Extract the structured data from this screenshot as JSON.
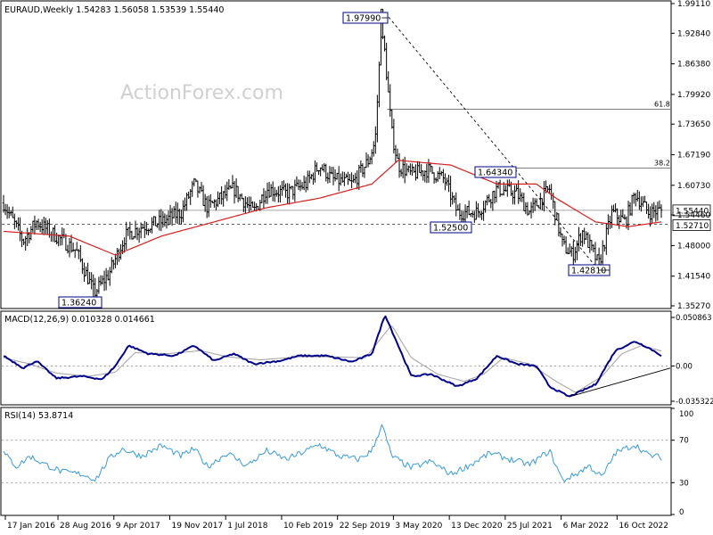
{
  "colors": {
    "price": "#000000",
    "ma": "#d42020",
    "macd": "#00008b",
    "signal": "#a0a0a0",
    "rsi": "#3a9ad9",
    "grid": "#c8c8c8",
    "frame": "#000000",
    "label_border": "#00008b",
    "watermark": "#d0d0d0"
  },
  "chart_data": [
    {
      "type": "bar",
      "panel": "price",
      "title": "EURAUD,Weekly  1.54283 1.56058 1.53539 1.55440",
      "watermark": "ActionForex.com",
      "ylim": [
        1.3527,
        1.9911
      ],
      "y_ticks": [
        1.9911,
        1.9284,
        1.8638,
        1.7992,
        1.7365,
        1.6719,
        1.6073,
        1.5446,
        1.48,
        1.4154,
        1.3527
      ],
      "x_tick_labels": [
        "17 Jan 2016",
        "28 Aug 2016",
        "9 Apr 2017",
        "19 Nov 2017",
        "1 Jul 2018",
        "10 Feb 2019",
        "22 Sep 2019",
        "3 May 2020",
        "13 Dec 2020",
        "25 Jul 2021",
        "6 Mar 2022",
        "16 Oct 2022"
      ],
      "price_labels": [
        "1.97990",
        "1.64340",
        "1.52500",
        "1.36240",
        "1.42810"
      ],
      "right_labels": [
        "1.55440",
        "1.52710"
      ],
      "fib_labels": [
        "61.8",
        "38.2"
      ],
      "levels": {
        "high": 1.9799,
        "fib_61_8": 1.7679,
        "fib_38_2": 1.6434,
        "last": 1.5544,
        "support": 1.525,
        "right_support": 1.5271,
        "low_2022": 1.4281,
        "low_2016": 1.3624
      },
      "trendline": {
        "from": [
          1.9799,
          0
        ],
        "to": [
          1.4281,
          1
        ]
      },
      "anchors": [
        {
          "t": 0.0,
          "c": 1.57
        },
        {
          "t": 0.03,
          "c": 1.49
        },
        {
          "t": 0.05,
          "c": 1.53
        },
        {
          "t": 0.08,
          "c": 1.5
        },
        {
          "t": 0.11,
          "c": 1.47
        },
        {
          "t": 0.138,
          "c": 1.38
        },
        {
          "t": 0.16,
          "c": 1.42
        },
        {
          "t": 0.185,
          "c": 1.5
        },
        {
          "t": 0.21,
          "c": 1.52
        },
        {
          "t": 0.24,
          "c": 1.53
        },
        {
          "t": 0.27,
          "c": 1.55
        },
        {
          "t": 0.29,
          "c": 1.61
        },
        {
          "t": 0.31,
          "c": 1.56
        },
        {
          "t": 0.35,
          "c": 1.6
        },
        {
          "t": 0.38,
          "c": 1.55
        },
        {
          "t": 0.4,
          "c": 1.6
        },
        {
          "t": 0.43,
          "c": 1.59
        },
        {
          "t": 0.46,
          "c": 1.61
        },
        {
          "t": 0.48,
          "c": 1.65
        },
        {
          "t": 0.5,
          "c": 1.62
        },
        {
          "t": 0.53,
          "c": 1.61
        },
        {
          "t": 0.555,
          "c": 1.66
        },
        {
          "t": 0.565,
          "c": 1.7
        },
        {
          "t": 0.575,
          "c": 1.96
        },
        {
          "t": 0.59,
          "c": 1.72
        },
        {
          "t": 0.6,
          "c": 1.65
        },
        {
          "t": 0.62,
          "c": 1.63
        },
        {
          "t": 0.645,
          "c": 1.64
        },
        {
          "t": 0.67,
          "c": 1.62
        },
        {
          "t": 0.69,
          "c": 1.55
        },
        {
          "t": 0.72,
          "c": 1.55
        },
        {
          "t": 0.75,
          "c": 1.6
        },
        {
          "t": 0.78,
          "c": 1.59
        },
        {
          "t": 0.8,
          "c": 1.55
        },
        {
          "t": 0.83,
          "c": 1.6
        },
        {
          "t": 0.85,
          "c": 1.48
        },
        {
          "t": 0.865,
          "c": 1.46
        },
        {
          "t": 0.88,
          "c": 1.51
        },
        {
          "t": 0.905,
          "c": 1.44
        },
        {
          "t": 0.925,
          "c": 1.55
        },
        {
          "t": 0.945,
          "c": 1.53
        },
        {
          "t": 0.96,
          "c": 1.59
        },
        {
          "t": 0.98,
          "c": 1.55
        },
        {
          "t": 1.0,
          "c": 1.5544
        }
      ],
      "ma_anchors": [
        {
          "t": 0.0,
          "v": 1.51
        },
        {
          "t": 0.1,
          "v": 1.5
        },
        {
          "t": 0.17,
          "v": 1.46
        },
        {
          "t": 0.24,
          "v": 1.5
        },
        {
          "t": 0.32,
          "v": 1.53
        },
        {
          "t": 0.4,
          "v": 1.56
        },
        {
          "t": 0.48,
          "v": 1.58
        },
        {
          "t": 0.56,
          "v": 1.61
        },
        {
          "t": 0.6,
          "v": 1.66
        },
        {
          "t": 0.68,
          "v": 1.65
        },
        {
          "t": 0.75,
          "v": 1.61
        },
        {
          "t": 0.81,
          "v": 1.61
        },
        {
          "t": 0.84,
          "v": 1.58
        },
        {
          "t": 0.9,
          "v": 1.53
        },
        {
          "t": 0.95,
          "v": 1.52
        },
        {
          "t": 1.0,
          "v": 1.53
        }
      ]
    },
    {
      "type": "line",
      "panel": "macd",
      "title": "MACD(12,26,9) 0.010328 0.014661",
      "ylim": [
        -0.0353,
        0.0509
      ],
      "y_tick_labels": [
        "0.050863",
        "0.00",
        "-0.035322"
      ],
      "y_ticks": [
        0.050863,
        0.0,
        -0.035322
      ],
      "series": [
        {
          "anchors": [
            {
              "t": 0.0,
              "v": 0.01
            },
            {
              "t": 0.03,
              "v": -0.002
            },
            {
              "t": 0.05,
              "v": 0.005
            },
            {
              "t": 0.08,
              "v": -0.012
            },
            {
              "t": 0.12,
              "v": -0.01
            },
            {
              "t": 0.15,
              "v": -0.013
            },
            {
              "t": 0.17,
              "v": 0.0
            },
            {
              "t": 0.19,
              "v": 0.02
            },
            {
              "t": 0.22,
              "v": 0.012
            },
            {
              "t": 0.26,
              "v": 0.01
            },
            {
              "t": 0.29,
              "v": 0.02
            },
            {
              "t": 0.32,
              "v": 0.005
            },
            {
              "t": 0.35,
              "v": 0.012
            },
            {
              "t": 0.38,
              "v": 0.002
            },
            {
              "t": 0.42,
              "v": 0.005
            },
            {
              "t": 0.45,
              "v": 0.01
            },
            {
              "t": 0.49,
              "v": 0.01
            },
            {
              "t": 0.53,
              "v": 0.004
            },
            {
              "t": 0.56,
              "v": 0.012
            },
            {
              "t": 0.58,
              "v": 0.05
            },
            {
              "t": 0.6,
              "v": 0.02
            },
            {
              "t": 0.62,
              "v": -0.01
            },
            {
              "t": 0.65,
              "v": -0.008
            },
            {
              "t": 0.69,
              "v": -0.02
            },
            {
              "t": 0.72,
              "v": -0.012
            },
            {
              "t": 0.75,
              "v": 0.01
            },
            {
              "t": 0.78,
              "v": 0.002
            },
            {
              "t": 0.81,
              "v": 0.0
            },
            {
              "t": 0.83,
              "v": -0.02
            },
            {
              "t": 0.86,
              "v": -0.03
            },
            {
              "t": 0.9,
              "v": -0.018
            },
            {
              "t": 0.93,
              "v": 0.015
            },
            {
              "t": 0.96,
              "v": 0.024
            },
            {
              "t": 0.98,
              "v": 0.018
            },
            {
              "t": 1.0,
              "v": 0.0103
            }
          ]
        },
        {
          "anchors": [
            {
              "t": 0.0,
              "v": 0.008
            },
            {
              "t": 0.04,
              "v": 0.002
            },
            {
              "t": 0.08,
              "v": -0.007
            },
            {
              "t": 0.13,
              "v": -0.01
            },
            {
              "t": 0.17,
              "v": -0.006
            },
            {
              "t": 0.2,
              "v": 0.013
            },
            {
              "t": 0.25,
              "v": 0.012
            },
            {
              "t": 0.3,
              "v": 0.015
            },
            {
              "t": 0.34,
              "v": 0.009
            },
            {
              "t": 0.39,
              "v": 0.006
            },
            {
              "t": 0.45,
              "v": 0.009
            },
            {
              "t": 0.5,
              "v": 0.009
            },
            {
              "t": 0.55,
              "v": 0.008
            },
            {
              "t": 0.59,
              "v": 0.04
            },
            {
              "t": 0.62,
              "v": 0.008
            },
            {
              "t": 0.66,
              "v": -0.008
            },
            {
              "t": 0.7,
              "v": -0.015
            },
            {
              "t": 0.73,
              "v": -0.008
            },
            {
              "t": 0.76,
              "v": 0.008
            },
            {
              "t": 0.8,
              "v": 0.002
            },
            {
              "t": 0.84,
              "v": -0.015
            },
            {
              "t": 0.87,
              "v": -0.026
            },
            {
              "t": 0.91,
              "v": -0.01
            },
            {
              "t": 0.94,
              "v": 0.012
            },
            {
              "t": 0.97,
              "v": 0.02
            },
            {
              "t": 1.0,
              "v": 0.0147
            }
          ]
        }
      ],
      "trendline": {
        "from": [
          -0.03,
          0.86
        ],
        "to": [
          -0.005,
          1.0
        ]
      }
    },
    {
      "type": "line",
      "panel": "rsi",
      "title": "RSI(14) 53.8714",
      "ylim": [
        0,
        100
      ],
      "y_ticks": [
        100,
        70,
        30,
        0
      ],
      "levels": [
        70,
        30
      ],
      "series": [
        {
          "anchors": [
            {
              "t": 0.0,
              "v": 58
            },
            {
              "t": 0.02,
              "v": 45
            },
            {
              "t": 0.04,
              "v": 55
            },
            {
              "t": 0.06,
              "v": 48
            },
            {
              "t": 0.09,
              "v": 40
            },
            {
              "t": 0.12,
              "v": 38
            },
            {
              "t": 0.14,
              "v": 33
            },
            {
              "t": 0.16,
              "v": 52
            },
            {
              "t": 0.18,
              "v": 62
            },
            {
              "t": 0.21,
              "v": 55
            },
            {
              "t": 0.24,
              "v": 65
            },
            {
              "t": 0.27,
              "v": 55
            },
            {
              "t": 0.29,
              "v": 62
            },
            {
              "t": 0.31,
              "v": 45
            },
            {
              "t": 0.34,
              "v": 58
            },
            {
              "t": 0.37,
              "v": 46
            },
            {
              "t": 0.4,
              "v": 60
            },
            {
              "t": 0.43,
              "v": 52
            },
            {
              "t": 0.46,
              "v": 60
            },
            {
              "t": 0.48,
              "v": 66
            },
            {
              "t": 0.51,
              "v": 55
            },
            {
              "t": 0.54,
              "v": 52
            },
            {
              "t": 0.56,
              "v": 60
            },
            {
              "t": 0.575,
              "v": 85
            },
            {
              "t": 0.59,
              "v": 55
            },
            {
              "t": 0.62,
              "v": 44
            },
            {
              "t": 0.65,
              "v": 50
            },
            {
              "t": 0.68,
              "v": 38
            },
            {
              "t": 0.71,
              "v": 47
            },
            {
              "t": 0.74,
              "v": 58
            },
            {
              "t": 0.77,
              "v": 52
            },
            {
              "t": 0.8,
              "v": 47
            },
            {
              "t": 0.83,
              "v": 60
            },
            {
              "t": 0.85,
              "v": 32
            },
            {
              "t": 0.87,
              "v": 38
            },
            {
              "t": 0.89,
              "v": 46
            },
            {
              "t": 0.91,
              "v": 35
            },
            {
              "t": 0.93,
              "v": 58
            },
            {
              "t": 0.96,
              "v": 66
            },
            {
              "t": 0.98,
              "v": 56
            },
            {
              "t": 1.0,
              "v": 53.87
            }
          ]
        }
      ]
    }
  ]
}
